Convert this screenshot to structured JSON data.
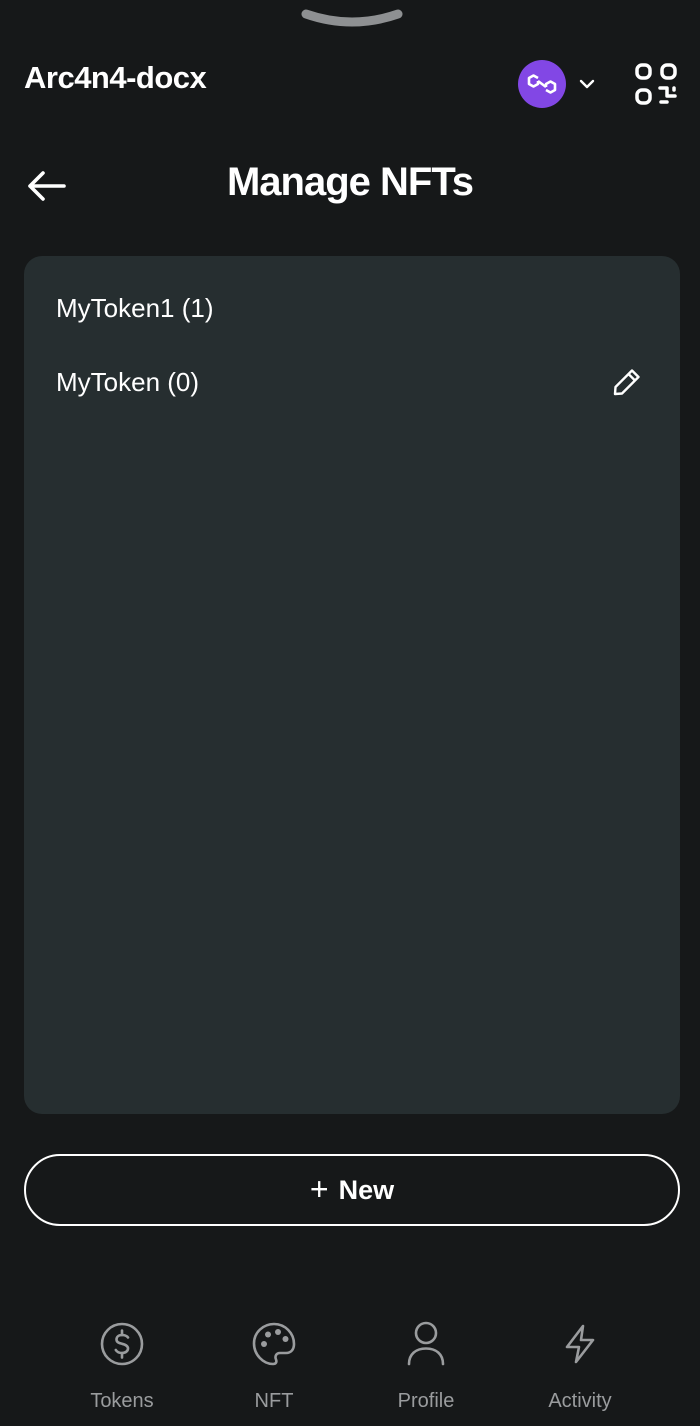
{
  "header": {
    "wallet_name": "Arc4n4-docx",
    "network_icon": "polygon-icon",
    "network_color": "#8247e5"
  },
  "page": {
    "title": "Manage NFTs"
  },
  "collections": [
    {
      "label": "MyToken1 (1)",
      "editable": false
    },
    {
      "label": "MyToken (0)",
      "editable": true
    }
  ],
  "actions": {
    "new_label": "New"
  },
  "bottom_nav": [
    {
      "label": "Tokens",
      "icon": "dollar-circle-icon"
    },
    {
      "label": "NFT",
      "icon": "palette-icon"
    },
    {
      "label": "Profile",
      "icon": "user-icon"
    },
    {
      "label": "Activity",
      "icon": "lightning-icon"
    }
  ],
  "colors": {
    "background": "#161819",
    "card": "#262e30",
    "muted": "#9a9c9e"
  }
}
